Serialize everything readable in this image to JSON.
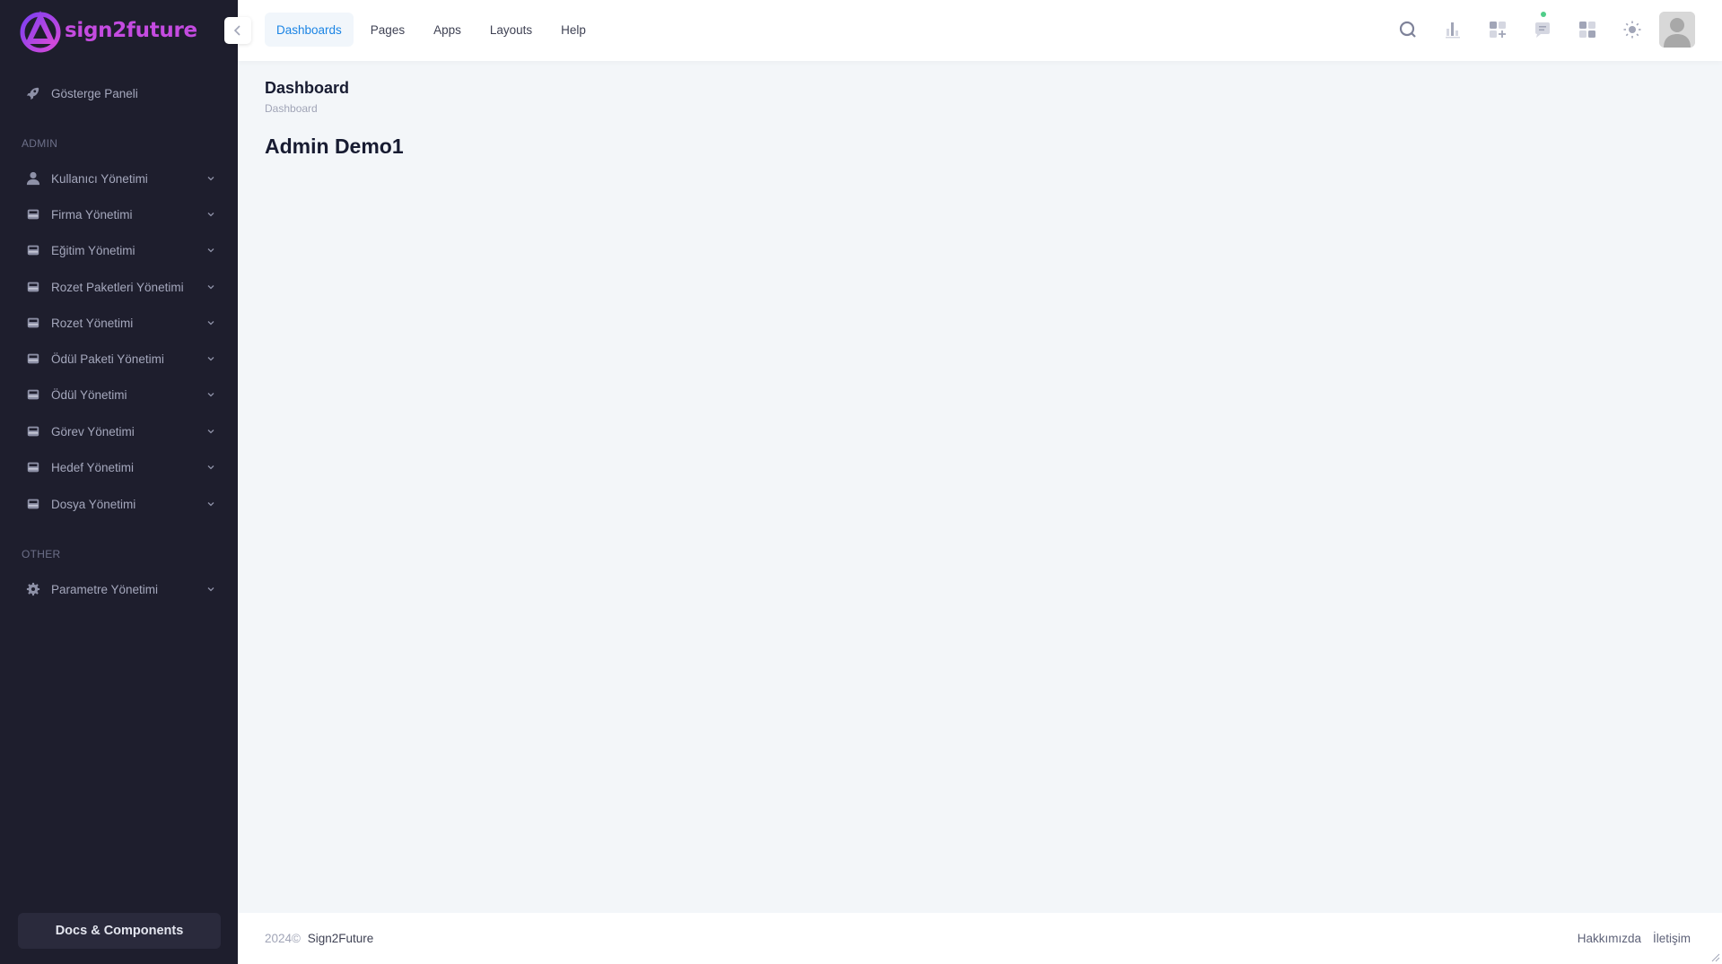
{
  "brand": {
    "name": "sign2future",
    "accent": "#c44be0"
  },
  "sidebar": {
    "top_item": {
      "label": "Gösterge Paneli",
      "icon": "rocket-icon"
    },
    "sections": [
      {
        "title": "ADMIN",
        "items": [
          {
            "label": "Kullanıcı Yönetimi",
            "icon": "user-icon"
          },
          {
            "label": "Firma Yönetimi",
            "icon": "folder-icon"
          },
          {
            "label": "Eğitim Yönetimi",
            "icon": "folder-icon"
          },
          {
            "label": "Rozet Paketleri Yönetimi",
            "icon": "folder-icon"
          },
          {
            "label": "Rozet Yönetimi",
            "icon": "folder-icon"
          },
          {
            "label": "Ödül Paketi Yönetimi",
            "icon": "folder-icon"
          },
          {
            "label": "Ödül Yönetimi",
            "icon": "folder-icon"
          },
          {
            "label": "Görev Yönetimi",
            "icon": "folder-icon"
          },
          {
            "label": "Hedef Yönetimi",
            "icon": "folder-icon"
          },
          {
            "label": "Dosya Yönetimi",
            "icon": "folder-icon"
          }
        ]
      },
      {
        "title": "OTHER",
        "items": [
          {
            "label": "Parametre Yönetimi",
            "icon": "gear-icon"
          }
        ]
      }
    ],
    "docs_button": "Docs & Components"
  },
  "header": {
    "menu": [
      {
        "label": "Dashboards",
        "active": true
      },
      {
        "label": "Pages"
      },
      {
        "label": "Apps"
      },
      {
        "label": "Layouts"
      },
      {
        "label": "Help"
      }
    ],
    "icons": [
      "search-icon",
      "chart-bar-icon",
      "apps-add-icon",
      "chat-icon",
      "grid-icon",
      "sun-icon"
    ],
    "notification_color": "#50cd89",
    "active_color": "#1b84e4"
  },
  "page": {
    "title": "Dashboard",
    "breadcrumb": "Dashboard",
    "content_title": "Admin Demo1"
  },
  "footer": {
    "year": "2024©",
    "brand": "Sign2Future",
    "links": [
      "Hakkımızda",
      "İletişim"
    ]
  }
}
